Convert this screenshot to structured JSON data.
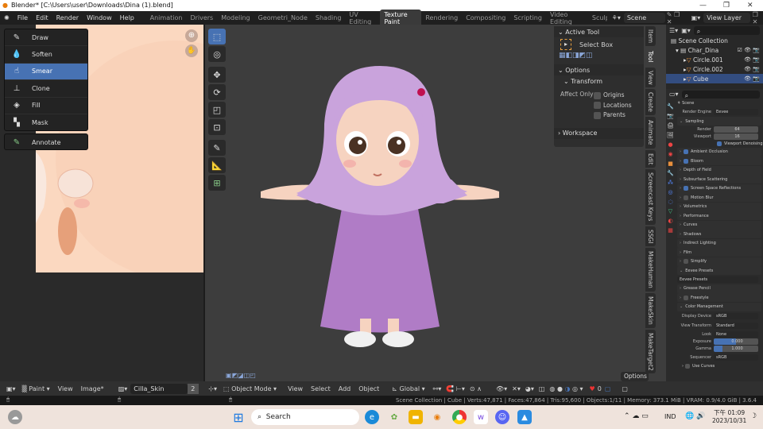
{
  "window": {
    "title": "Blender* [C:\\Users\\user\\Downloads\\Dina (1).blend]",
    "minimize": "—",
    "restore": "❐",
    "close": "✕"
  },
  "menu": [
    "File",
    "Edit",
    "Render",
    "Window",
    "Help"
  ],
  "workspaces": [
    "Animation",
    "Drivers",
    "Modeling",
    "Geometri_Node",
    "Shading",
    "UV Editing",
    "Texture Paint",
    "Rendering",
    "Compositing",
    "Scripting",
    "Video Editing",
    "Sculpting"
  ],
  "active_workspace": "Texture Paint",
  "scene": "Scene",
  "view_layer": "View Layer",
  "paint_tools": [
    {
      "label": "Draw",
      "icon": "brush-icon"
    },
    {
      "label": "Soften",
      "icon": "drop-icon"
    },
    {
      "label": "Smear",
      "icon": "smear-icon",
      "selected": true
    },
    {
      "label": "Clone",
      "icon": "stamp-icon"
    },
    {
      "label": "Fill",
      "icon": "bucket-icon"
    },
    {
      "label": "Mask",
      "icon": "mask-icon"
    }
  ],
  "annotate": "Annotate",
  "npanel": {
    "active_tool": "Active Tool",
    "tool_name": "Select Box",
    "options": "Options",
    "transform": "Transform",
    "affect_only": "Affect Only",
    "origins": "Origins",
    "locations": "Locations",
    "parents": "Parents",
    "workspace": "Workspace"
  },
  "ntabs": [
    "Item",
    "Tool",
    "View",
    "Create",
    "Animate",
    "Edit",
    "Screencast Keys",
    "SSGI",
    "MakeHuman",
    "MakeSkin",
    "MakeTarget2"
  ],
  "outliner": {
    "root": "Scene Collection",
    "items": [
      {
        "label": "Char_Dina",
        "type": "collection"
      },
      {
        "label": "Circle.001",
        "type": "mesh"
      },
      {
        "label": "Circle.002",
        "type": "mesh"
      },
      {
        "label": "Cube",
        "type": "mesh",
        "selected": true
      }
    ]
  },
  "properties": {
    "context": "Scene",
    "render_engine_label": "Render Engine",
    "render_engine": "Eevee",
    "sampling": "Sampling",
    "render_label": "Render",
    "render": "64",
    "viewport_label": "Viewport",
    "viewport": "16",
    "viewport_denoising": "Viewport Denoising",
    "panels": [
      {
        "label": "Ambient Occlusion",
        "check": true
      },
      {
        "label": "Bloom",
        "check": true
      },
      {
        "label": "Depth of Field"
      },
      {
        "label": "Subsurface Scattering"
      },
      {
        "label": "Screen Space Reflections",
        "check": true
      },
      {
        "label": "Motion Blur",
        "check": false
      },
      {
        "label": "Volumetrics"
      },
      {
        "label": "Performance"
      },
      {
        "label": "Curves"
      },
      {
        "label": "Shadows"
      },
      {
        "label": "Indirect Lighting"
      },
      {
        "label": "Film"
      },
      {
        "label": "Simplify",
        "check": false
      },
      {
        "label": "Eevee Presets",
        "open": true
      }
    ],
    "eevee_presets": "Eevee Presets",
    "grease_pencil": "Grease Pencil",
    "freestyle": "Freestyle",
    "color_management": "Color Management",
    "display_device_label": "Display Device",
    "display_device": "sRGB",
    "view_transform_label": "View Transform",
    "view_transform": "Standard",
    "look_label": "Look",
    "look": "None",
    "exposure_label": "Exposure",
    "exposure": "0.000",
    "gamma_label": "Gamma",
    "gamma": "1.000",
    "sequencer_label": "Sequencer",
    "sequencer": "sRGB",
    "use_curves": "Use Curves"
  },
  "image_header": {
    "mode": "Paint",
    "view": "View",
    "image": "Image*",
    "image_name": "Cilla_Skin",
    "users": "2"
  },
  "view3d_header": {
    "mode": "Object Mode",
    "view": "View",
    "select": "Select",
    "add": "Add",
    "object": "Object",
    "orientation": "Global",
    "options": "Options",
    "overlay_count": "0"
  },
  "status": "Scene Collection | Cube | Verts:47,871 | Faces:47,864 | Tris:95,600 | Objects:1/11 | Memory: 373.1 MiB | VRAM: 0.9/4.0 GiB | 3.6.4",
  "taskbar": {
    "search": "Search",
    "lang": "IND",
    "time": "下午 01:09",
    "date": "2023/10/31"
  },
  "colors": {
    "accent": "#4772b3",
    "hijab": "#c9a3dc",
    "dress": "#b07cc6",
    "skin": "#f6d3c0"
  }
}
